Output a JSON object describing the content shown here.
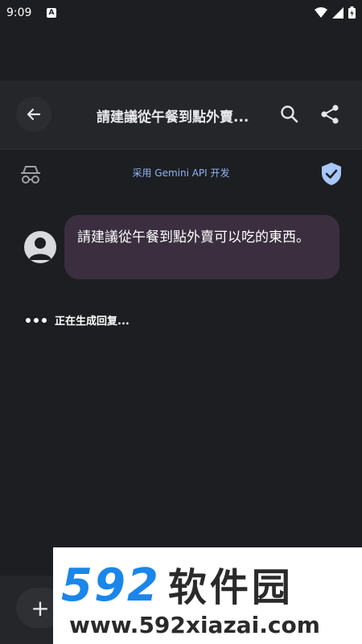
{
  "status": {
    "time": "9:09",
    "notif_badge": "A"
  },
  "header": {
    "title": "請建議從午餐到點外賣...",
    "back_icon": "arrow-left-icon",
    "search_icon": "search-icon",
    "share_icon": "share-icon"
  },
  "info": {
    "powered_by": "采用 Gemini API 开发",
    "incognito_icon": "incognito-icon",
    "shield_icon": "shield-check-icon"
  },
  "message": {
    "text": "請建議從午餐到點外賣可以吃的東西。",
    "avatar_icon": "user-avatar-icon"
  },
  "generating": {
    "text": "正在生成回复..."
  },
  "composer": {
    "add_label": "+"
  },
  "watermark": {
    "numbers": "592",
    "brand": "软件园",
    "url": "www.592xiazai.com"
  },
  "colors": {
    "background": "#1d1e21",
    "bubble": "#3a2e3f",
    "accent": "#8fb4f5",
    "shield": "#a8c7fa"
  }
}
